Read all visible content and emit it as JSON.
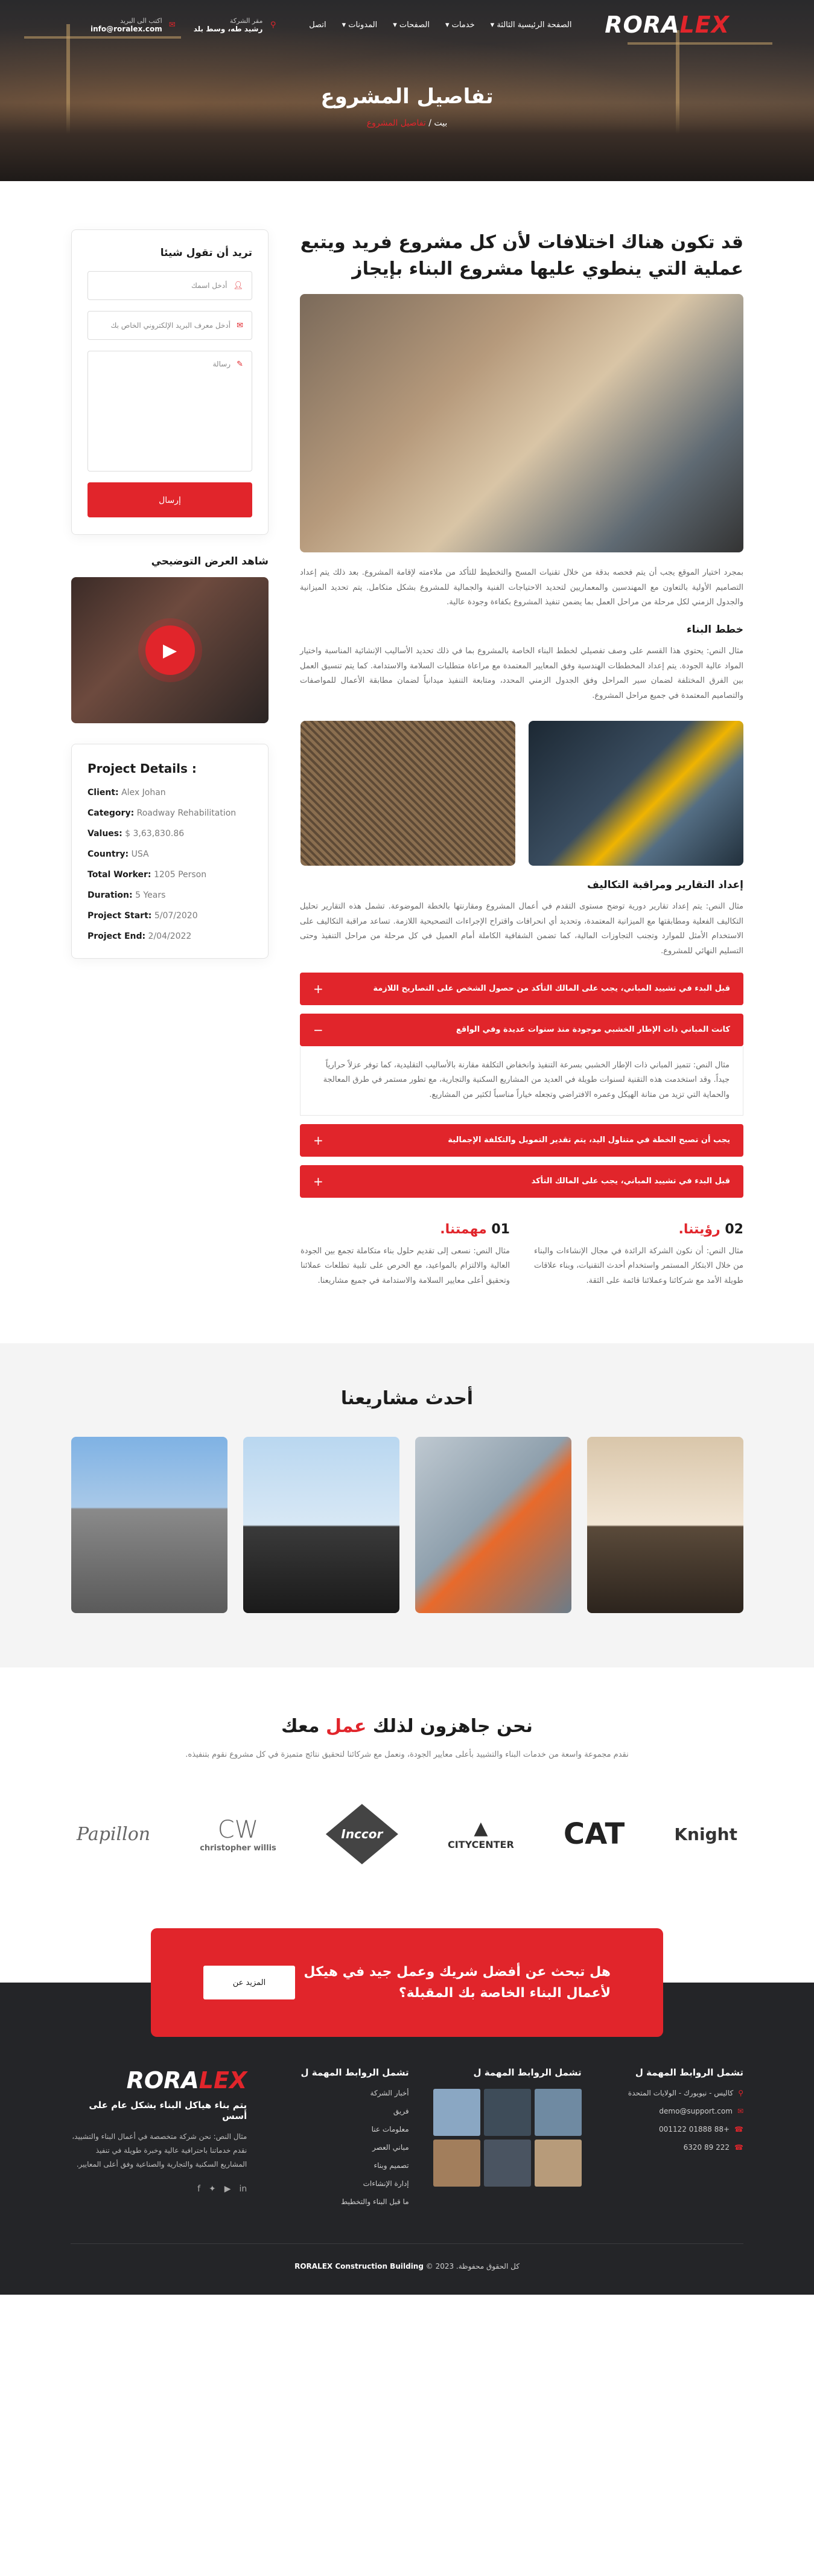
{
  "brand": {
    "name_main": "RORA",
    "name_accent": "LEX"
  },
  "nav": [
    "الصفحة الرئيسية الثالثة",
    "خدمات",
    "الصفحات",
    "المدونات",
    "اتصل"
  ],
  "contact_top": [
    {
      "icon": "envelope-icon",
      "label": "اكتب الى البريد",
      "value": "info@roralex.com"
    },
    {
      "icon": "map-pin-icon",
      "label": "مقر الشركة",
      "value": "رشيد طه، وسط بلد"
    }
  ],
  "hero": {
    "title": "تفاصيل المشروع",
    "crumb_home": "بيت",
    "crumb_sep": " / ",
    "crumb_current": "تفاصيل المشروع"
  },
  "main": {
    "title": "قد تكون هناك اختلافات لأن كل مشروع فريد ويتبع عملية التي ينطوي عليها مشروع البناء بإيجاز",
    "intro": "بمجرد اختيار الموقع يجب أن يتم فحصه بدقة من خلال تقنيات المسح والتخطيط للتأكد من ملاءمته لإقامة المشروع. بعد ذلك يتم إعداد التصاميم الأولية بالتعاون مع المهندسين والمعماريين لتحديد الاحتياجات الفنية والجمالية للمشروع بشكل متكامل. يتم تحديد الميزانية والجدول الزمني لكل مرحلة من مراحل العمل بما يضمن تنفيذ المشروع بكفاءة وجودة عالية.",
    "sections": [
      {
        "title": "خطط البناء",
        "text": "مثال النص: يحتوي هذا القسم على وصف تفصيلي لخطط البناء الخاصة بالمشروع بما في ذلك تحديد الأساليب الإنشائية المناسبة واختيار المواد عالية الجودة. يتم إعداد المخططات الهندسية وفق المعايير المعتمدة مع مراعاة متطلبات السلامة والاستدامة. كما يتم تنسيق العمل بين الفرق المختلفة لضمان سير المراحل وفق الجدول الزمني المحدد، ومتابعة التنفيذ ميدانياً لضمان مطابقة الأعمال للمواصفات والتصاميم المعتمدة في جميع مراحل المشروع."
      },
      {
        "title": "إعداد التقارير ومراقبة التكاليف",
        "text": "مثال النص: يتم إعداد تقارير دورية توضح مستوى التقدم في أعمال المشروع ومقارنتها بالخطة الموضوعة. تشمل هذه التقارير تحليل التكاليف الفعلية ومطابقتها مع الميزانية المعتمدة، وتحديد أي انحرافات واقتراح الإجراءات التصحيحية اللازمة. تساعد مراقبة التكاليف على الاستخدام الأمثل للموارد وتجنب التجاوزات المالية، كما تضمن الشفافية الكاملة أمام العميل في كل مرحلة من مراحل التنفيذ وحتى التسليم النهائي للمشروع."
      }
    ],
    "accordion": [
      {
        "title": "قبل البدء في تشييد المباني، يجب على المالك التأكد من حصول الشخص على التصاريح اللازمة",
        "open": false,
        "body": ""
      },
      {
        "title": "كانت المباني ذات الإطار الخشبي موجودة منذ سنوات عديدة وفي الواقع",
        "open": true,
        "body": "مثال النص: تتميز المباني ذات الإطار الخشبي بسرعة التنفيذ وانخفاض التكلفة مقارنة بالأساليب التقليدية، كما توفر عزلاً حرارياً جيداً. وقد استخدمت هذه التقنية لسنوات طويلة في العديد من المشاريع السكنية والتجارية، مع تطور مستمر في طرق المعالجة والحماية التي تزيد من متانة الهيكل وعمره الافتراضي وتجعله خياراً مناسباً لكثير من المشاريع."
      },
      {
        "title": "يجب أن تصبح الخطة في متناول اليد، يتم تقدير التمويل والتكلفة الإجمالية",
        "open": false,
        "body": ""
      },
      {
        "title": "قبل البدء في تشييد المباني، يجب على المالك التأكد",
        "open": false,
        "body": ""
      }
    ],
    "mission": [
      {
        "num": "01",
        "title": "مهمتنا.",
        "text": "مثال النص: نسعى إلى تقديم حلول بناء متكاملة تجمع بين الجودة العالية والالتزام بالمواعيد، مع الحرص على تلبية تطلعات عملائنا وتحقيق أعلى معايير السلامة والاستدامة في جميع مشاريعنا."
      },
      {
        "num": "02",
        "title": "رؤيتنا.",
        "text": "مثال النص: أن نكون الشركة الرائدة في مجال الإنشاءات والبناء من خلال الابتكار المستمر واستخدام أحدث التقنيات، وبناء علاقات طويلة الأمد مع شركائنا وعملائنا قائمة على الثقة."
      }
    ]
  },
  "sidebar": {
    "form_title": "تريد أن تقول شيئا",
    "name_placeholder": "أدخل اسمك",
    "email_placeholder": "أدخل معرف البريد الإلكتروني الخاص بك",
    "message_placeholder": "رسالة",
    "submit": "إرسال",
    "video_title": "شاهد العرض التوضيحي",
    "details_title": "Project Details :",
    "details": [
      {
        "label": "Client:",
        "value": "Alex Johan"
      },
      {
        "label": "Category:",
        "value": "Roadway Rehabilitation"
      },
      {
        "label": "Values:",
        "value": "$ 3,63,830.86"
      },
      {
        "label": "Country:",
        "value": "USA"
      },
      {
        "label": "Total Worker:",
        "value": "1205 Person"
      },
      {
        "label": "Duration:",
        "value": "5 Years"
      },
      {
        "label": "Project Start:",
        "value": "5/07/2020"
      },
      {
        "label": "Project End:",
        "value": "2/04/2022"
      }
    ]
  },
  "latest": {
    "title": "أحدث مشاريعنا"
  },
  "ready": {
    "title_pre": "نحن جاهزون لذلك ",
    "title_accent": "عمل",
    "title_post": " معك",
    "sub": "نقدم مجموعة واسعة من خدمات البناء والتشييد بأعلى معايير الجودة، ونعمل مع شركائنا لتحقيق نتائج متميزة في كل مشروع نقوم بتنفيذه."
  },
  "brands": [
    "Papillon",
    "christopher willis",
    "Inccor",
    "CITYCENTER",
    "CAT",
    "Knight"
  ],
  "cta": {
    "text": "هل تبحث عن أفضل شريك وعمل جيد في هيكل لأعمال البناء الخاصة بك المقبلة؟",
    "button": "المزيد عن"
  },
  "footer": {
    "contact_title": "تشمل الروابط المهمة ل",
    "address": "كاليس - نيويورك - الولايات المتحدة",
    "email": "demo@support.com",
    "phone1": "+88 01888 001122",
    "phone2": "222 89 6320",
    "gallery_title": "تشمل الروابط المهمة ل",
    "links_title": "تشمل الروابط المهمة ل",
    "links": [
      "أخبار الشركة",
      "فريق",
      "معلومات عنا",
      "مباني العصر",
      "تصميم وبناء",
      "إدارة الإنشاءات",
      "ما قبل البناء والتخطيط"
    ],
    "tagline": "يتم بناء هياكل البناء بشكل عام على أسس",
    "about": "مثال النص: نحن شركة متخصصة في أعمال البناء والتشييد، نقدم خدماتنا باحترافية عالية وخبرة طويلة في تنفيذ المشاريع السكنية والتجارية والصناعية وفق أعلى المعايير.",
    "copyright_pre": "كل الحقوق محفوظة. ",
    "copyright_brand": "RORALEX Construction Building",
    "copyright_post": " © 2023"
  }
}
